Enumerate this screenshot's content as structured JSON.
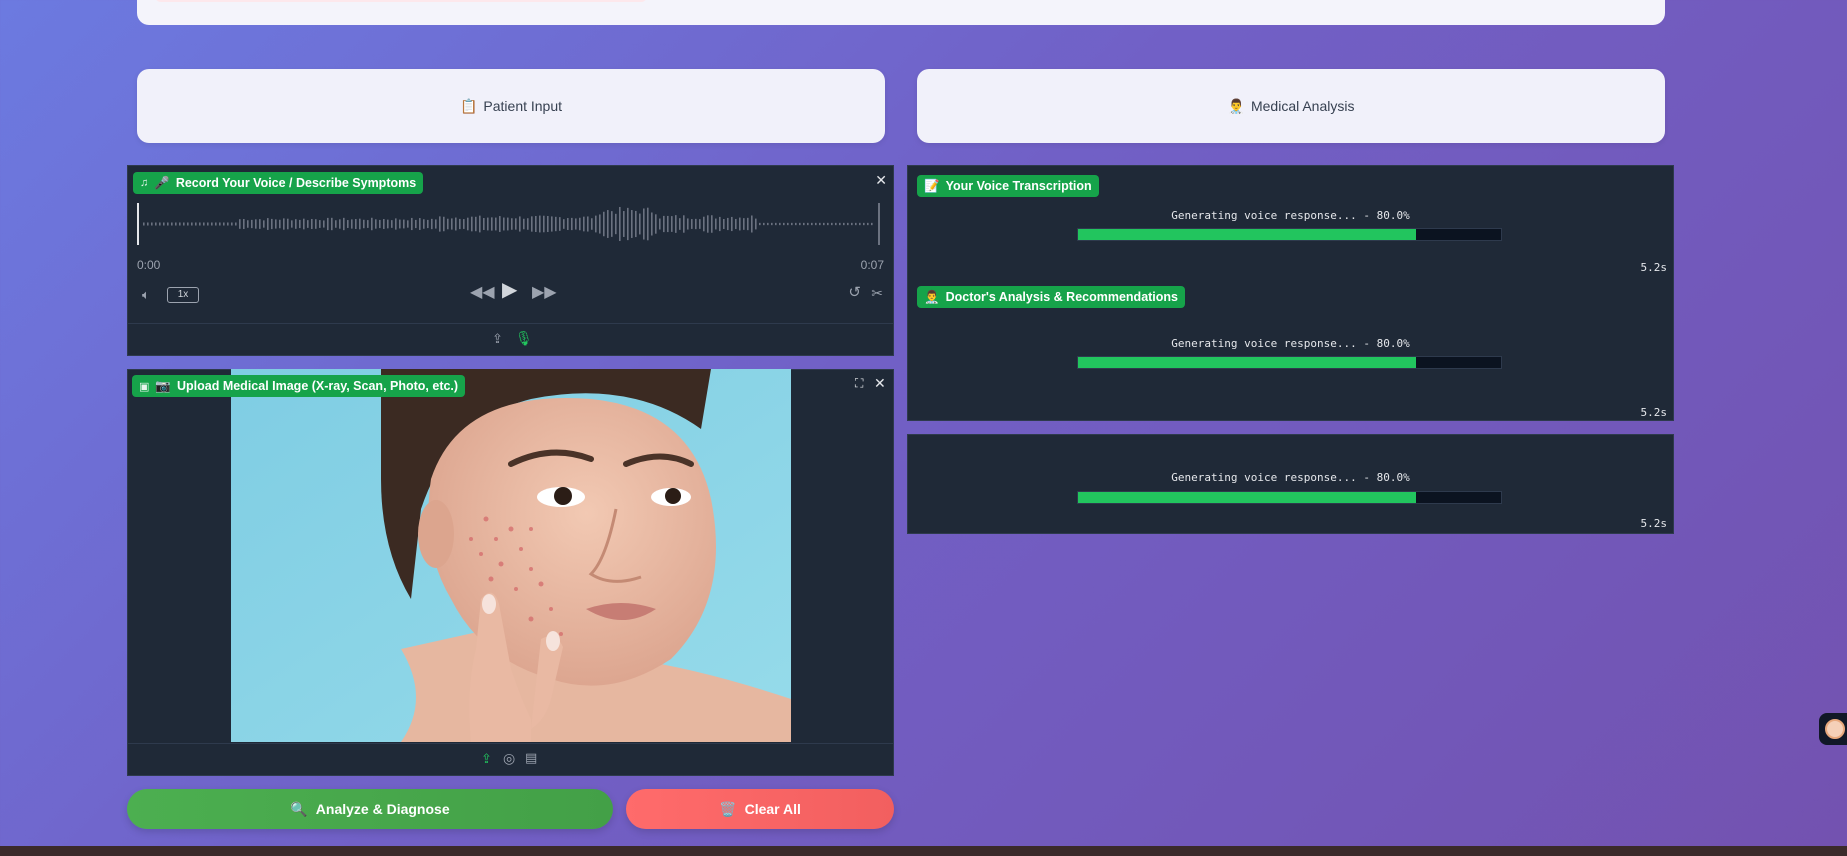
{
  "sections": {
    "patient_input": {
      "icon": "clipboard-icon",
      "emoji": "📋",
      "label": "Patient Input"
    },
    "medical_analysis": {
      "icon": "doctor-icon",
      "emoji": "👨‍⚕️",
      "label": "Medical Analysis"
    }
  },
  "audio": {
    "label_icon": "music-icon",
    "label_emoji": "🎤",
    "label": "Record Your Voice / Describe Symptoms",
    "time_start": "0:00",
    "time_end": "0:07",
    "speed": "1x"
  },
  "image_upload": {
    "label_icon": "image-icon",
    "label_emoji": "📷",
    "label": "Upload Medical Image (X-ray, Scan, Photo, etc.)"
  },
  "outputs": {
    "transcription": {
      "emoji": "📝",
      "label": "Your Voice Transcription",
      "status": "Generating voice response... - 80.0%",
      "progress": 0.8,
      "elapsed": "5.2s"
    },
    "analysis": {
      "emoji": "👨‍⚕️",
      "label": "Doctor's Analysis & Recommendations",
      "status": "Generating voice response... - 80.0%",
      "progress": 0.8,
      "elapsed": "5.2s"
    },
    "voice": {
      "status": "Generating voice response... - 80.0%",
      "progress": 0.8,
      "elapsed": "5.2s"
    }
  },
  "actions": {
    "analyze": {
      "emoji": "🔍",
      "label": "Analyze & Diagnose",
      "color": "#43a047"
    },
    "clear": {
      "emoji": "🗑️",
      "label": "Clear All",
      "color": "#f25f5f"
    }
  },
  "colors": {
    "accent_green": "#16a34a",
    "progress_green": "#22c55e",
    "panel_bg": "#1f2937"
  }
}
